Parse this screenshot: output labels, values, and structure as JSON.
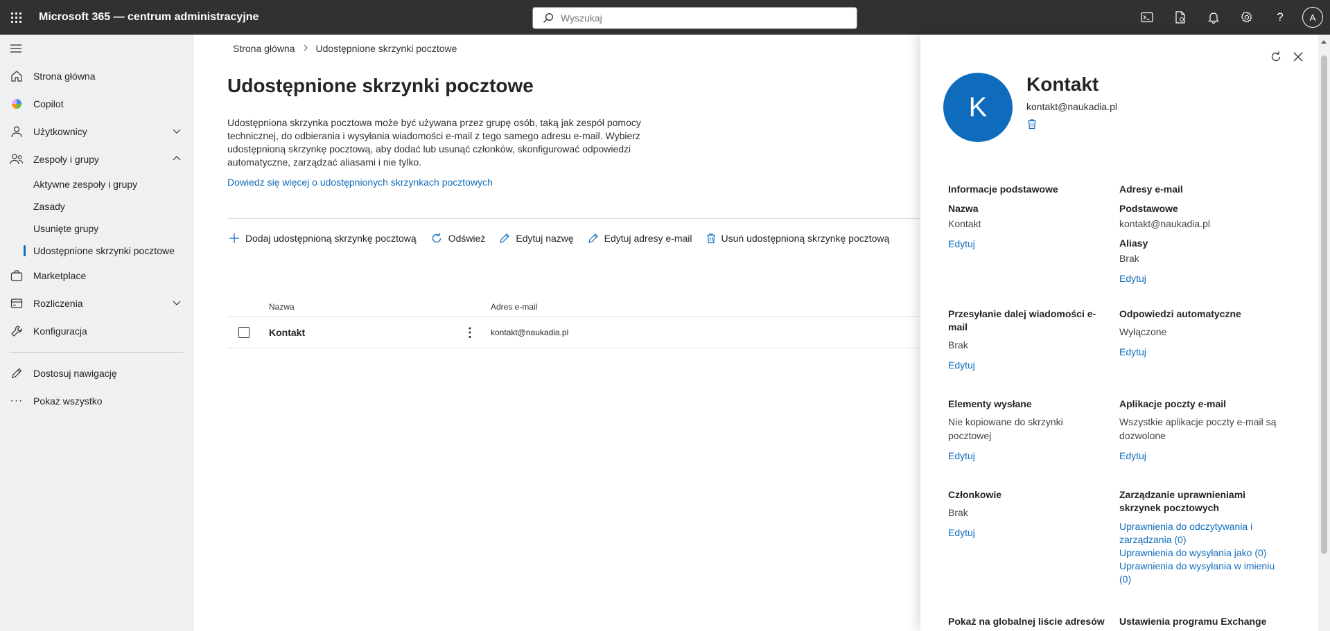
{
  "topbar": {
    "title": "Microsoft 365 — centrum administracyjne",
    "search_placeholder": "Wyszukaj",
    "user_initial": "A"
  },
  "nav": {
    "items": [
      {
        "label": "Strona główna",
        "icon": "home-icon"
      },
      {
        "label": "Copilot",
        "icon": "copilot-icon"
      },
      {
        "label": "Użytkownicy",
        "icon": "person-icon",
        "expandable": true
      },
      {
        "label": "Zespoły i grupy",
        "icon": "people-icon",
        "expanded": true
      }
    ],
    "sub_items": [
      {
        "label": "Aktywne zespoły i grupy"
      },
      {
        "label": "Zasady"
      },
      {
        "label": "Usunięte grupy"
      },
      {
        "label": "Udostępnione skrzynki pocztowe",
        "active": true
      }
    ],
    "items2": [
      {
        "label": "Marketplace",
        "icon": "bag-icon"
      },
      {
        "label": "Rozliczenia",
        "icon": "billing-icon",
        "expandable": true
      },
      {
        "label": "Konfiguracja",
        "icon": "wrench-icon"
      }
    ],
    "customize": "Dostosuj nawigację",
    "show_all": "Pokaż wszystko"
  },
  "breadcrumb": {
    "home": "Strona główna",
    "current": "Udostępnione skrzynki pocztowe"
  },
  "page": {
    "title": "Udostępnione skrzynki pocztowe",
    "description": "Udostępniona skrzynka pocztowa może być używana przez grupę osób, taką jak zespół pomocy technicznej, do odbierania i wysyłania wiadomości e-mail z tego samego adresu e-mail. Wybierz udostępnioną skrzynkę pocztową, aby dodać lub usunąć członków, skonfigurować odpowiedzi automatyczne, zarządzać aliasami i nie tylko.",
    "learn_more": "Dowiedz się więcej o udostępnionych skrzynkach pocztowych"
  },
  "commands": {
    "add": "Dodaj udostępnioną skrzynkę pocztową",
    "refresh": "Odśwież",
    "edit_name": "Edytuj nazwę",
    "edit_emails": "Edytuj adresy e-mail",
    "delete": "Usuń udostępnioną skrzynkę pocztową"
  },
  "table": {
    "columns": {
      "name": "Nazwa",
      "email": "Adres e-mail"
    },
    "rows": [
      {
        "name": "Kontakt",
        "email": "kontakt@naukadia.pl"
      }
    ]
  },
  "panel": {
    "avatar_letter": "K",
    "name": "Kontakt",
    "email": "kontakt@naukadia.pl",
    "basic_info": {
      "heading": "Informacje podstawowe",
      "label": "Nazwa",
      "value": "Kontakt",
      "edit": "Edytuj"
    },
    "emails": {
      "heading": "Adresy e-mail",
      "primary_label": "Podstawowe",
      "primary_value": "kontakt@naukadia.pl",
      "aliases_label": "Aliasy",
      "aliases_value": "Brak",
      "edit": "Edytuj"
    },
    "forwarding": {
      "heading": "Przesyłanie dalej wiadomości e-mail",
      "value": "Brak",
      "edit": "Edytuj"
    },
    "auto_replies": {
      "heading": "Odpowiedzi automatyczne",
      "value": "Wyłączone",
      "edit": "Edytuj"
    },
    "sent_items": {
      "heading": "Elementy wysłane",
      "value": "Nie kopiowane do skrzynki pocztowej",
      "edit": "Edytuj"
    },
    "email_apps": {
      "heading": "Aplikacje poczty e-mail",
      "value": "Wszystkie aplikacje poczty e-mail są dozwolone",
      "edit": "Edytuj"
    },
    "members": {
      "heading": "Członkowie",
      "value": "Brak",
      "edit": "Edytuj"
    },
    "permissions": {
      "heading": "Zarządzanie uprawnieniami skrzynek pocztowych",
      "read_manage": "Uprawnienia do odczytywania i zarządzania (0)",
      "send_as": "Uprawnienia do wysyłania jako (0)",
      "send_on_behalf": "Uprawnienia do wysyłania w imieniu (0)"
    },
    "gal": {
      "heading": "Pokaż na globalnej liście adresów"
    },
    "exchange": {
      "heading": "Ustawienia programu Exchange"
    }
  },
  "colors": {
    "accent": "#0f6cbd",
    "topbar": "#323130",
    "nav_bg": "#f0f0f0"
  }
}
